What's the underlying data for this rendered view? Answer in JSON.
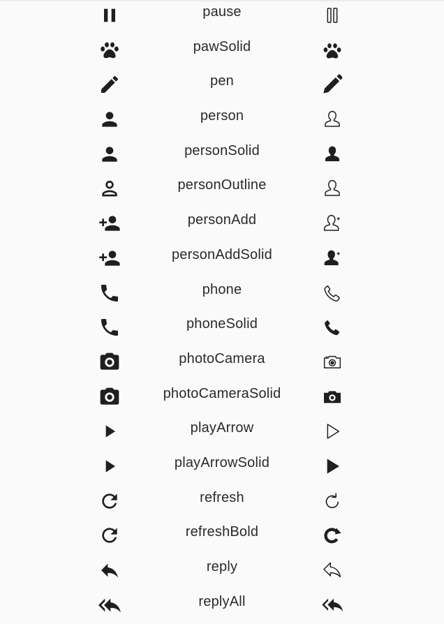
{
  "rows": [
    {
      "label": "pause",
      "left_icon": "pause-icon",
      "right_icon": "pause-outline-icon"
    },
    {
      "label": "pawSolid",
      "left_icon": "paw-icon",
      "right_icon": "paw-solid-icon"
    },
    {
      "label": "pen",
      "left_icon": "pen-icon",
      "right_icon": "pen-solid-icon"
    },
    {
      "label": "person",
      "left_icon": "person-icon",
      "right_icon": "person-outline-icon"
    },
    {
      "label": "personSolid",
      "left_icon": "person-icon",
      "right_icon": "person-solid-icon"
    },
    {
      "label": "personOutline",
      "left_icon": "person-outline-icon",
      "right_icon": "person-outline-icon"
    },
    {
      "label": "personAdd",
      "left_icon": "person-add-icon",
      "right_icon": "person-add-outline-icon"
    },
    {
      "label": "personAddSolid",
      "left_icon": "person-add-icon",
      "right_icon": "person-add-solid-icon"
    },
    {
      "label": "phone",
      "left_icon": "phone-icon",
      "right_icon": "phone-outline-icon"
    },
    {
      "label": "phoneSolid",
      "left_icon": "phone-icon",
      "right_icon": "phone-solid-icon"
    },
    {
      "label": "photoCamera",
      "left_icon": "camera-icon",
      "right_icon": "camera-outline-icon"
    },
    {
      "label": "photoCameraSolid",
      "left_icon": "camera-icon",
      "right_icon": "camera-solid-icon"
    },
    {
      "label": "playArrow",
      "left_icon": "play-icon",
      "right_icon": "play-outline-icon"
    },
    {
      "label": "playArrowSolid",
      "left_icon": "play-icon",
      "right_icon": "play-solid-icon"
    },
    {
      "label": "refresh",
      "left_icon": "refresh-icon",
      "right_icon": "refresh-thin-icon"
    },
    {
      "label": "refreshBold",
      "left_icon": "refresh-icon",
      "right_icon": "refresh-bold-icon"
    },
    {
      "label": "reply",
      "left_icon": "reply-icon",
      "right_icon": "reply-outline-icon"
    },
    {
      "label": "replyAll",
      "left_icon": "reply-all-icon",
      "right_icon": "reply-all-solid-icon"
    }
  ],
  "colors": {
    "icon": "#1f1f1f",
    "text": "#2a2a2a",
    "background": "#fafafa"
  }
}
